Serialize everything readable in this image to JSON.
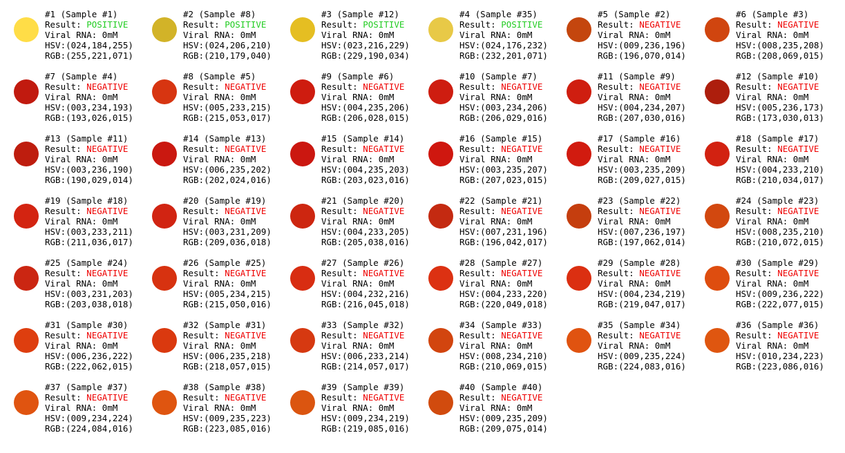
{
  "labels": {
    "result": "Result: ",
    "viral": "Viral RNA: ",
    "hsv": "HSV:",
    "rgb": "RGB:",
    "sample_word": "Sample"
  },
  "colors": {
    "positive": "#22cc22",
    "negative": "#ee0000"
  },
  "samples": [
    {
      "id": "#1",
      "sample": "#1",
      "result": "POSITIVE",
      "rna": "0mM",
      "hsv": "(024,184,255)",
      "rgb": "(255,221,071)",
      "color": "#ffdd47"
    },
    {
      "id": "#2",
      "sample": "#8",
      "result": "POSITIVE",
      "rna": "0mM",
      "hsv": "(024,206,210)",
      "rgb": "(210,179,040)",
      "color": "#d2b328"
    },
    {
      "id": "#3",
      "sample": "#12",
      "result": "POSITIVE",
      "rna": "0mM",
      "hsv": "(023,216,229)",
      "rgb": "(229,190,034)",
      "color": "#e5be22"
    },
    {
      "id": "#4",
      "sample": "#35",
      "result": "POSITIVE",
      "rna": "0mM",
      "hsv": "(024,176,232)",
      "rgb": "(232,201,071)",
      "color": "#e8c947"
    },
    {
      "id": "#5",
      "sample": "#2",
      "result": "NEGATIVE",
      "rna": "0mM",
      "hsv": "(009,236,196)",
      "rgb": "(196,070,014)",
      "color": "#c4460e"
    },
    {
      "id": "#6",
      "sample": "#3",
      "result": "NEGATIVE",
      "rna": "0mM",
      "hsv": "(008,235,208)",
      "rgb": "(208,069,015)",
      "color": "#d0450f"
    },
    {
      "id": "#7",
      "sample": "#4",
      "result": "NEGATIVE",
      "rna": "0mM",
      "hsv": "(003,234,193)",
      "rgb": "(193,026,015)",
      "color": "#c11a0f"
    },
    {
      "id": "#8",
      "sample": "#5",
      "result": "NEGATIVE",
      "rna": "0mM",
      "hsv": "(005,233,215)",
      "rgb": "(215,053,017)",
      "color": "#d73511"
    },
    {
      "id": "#9",
      "sample": "#6",
      "result": "NEGATIVE",
      "rna": "0mM",
      "hsv": "(004,235,206)",
      "rgb": "(206,028,015)",
      "color": "#ce1c0f"
    },
    {
      "id": "#10",
      "sample": "#7",
      "result": "NEGATIVE",
      "rna": "0mM",
      "hsv": "(003,234,206)",
      "rgb": "(206,029,016)",
      "color": "#ce1d10"
    },
    {
      "id": "#11",
      "sample": "#9",
      "result": "NEGATIVE",
      "rna": "0mM",
      "hsv": "(004,234,207)",
      "rgb": "(207,030,016)",
      "color": "#cf1e10"
    },
    {
      "id": "#12",
      "sample": "#10",
      "result": "NEGATIVE",
      "rna": "0mM",
      "hsv": "(005,236,173)",
      "rgb": "(173,030,013)",
      "color": "#ad1e0d"
    },
    {
      "id": "#13",
      "sample": "#11",
      "result": "NEGATIVE",
      "rna": "0mM",
      "hsv": "(003,236,190)",
      "rgb": "(190,029,014)",
      "color": "#be1d0e"
    },
    {
      "id": "#14",
      "sample": "#13",
      "result": "NEGATIVE",
      "rna": "0mM",
      "hsv": "(006,235,202)",
      "rgb": "(202,024,016)",
      "color": "#ca1810"
    },
    {
      "id": "#15",
      "sample": "#14",
      "result": "NEGATIVE",
      "rna": "0mM",
      "hsv": "(004,235,203)",
      "rgb": "(203,023,016)",
      "color": "#cb1710"
    },
    {
      "id": "#16",
      "sample": "#15",
      "result": "NEGATIVE",
      "rna": "0mM",
      "hsv": "(003,235,207)",
      "rgb": "(207,023,015)",
      "color": "#cf170f"
    },
    {
      "id": "#17",
      "sample": "#16",
      "result": "NEGATIVE",
      "rna": "0mM",
      "hsv": "(003,235,209)",
      "rgb": "(209,027,015)",
      "color": "#d11b0f"
    },
    {
      "id": "#18",
      "sample": "#17",
      "result": "NEGATIVE",
      "rna": "0mM",
      "hsv": "(004,233,210)",
      "rgb": "(210,034,017)",
      "color": "#d22211"
    },
    {
      "id": "#19",
      "sample": "#18",
      "result": "NEGATIVE",
      "rna": "0mM",
      "hsv": "(003,233,211)",
      "rgb": "(211,036,017)",
      "color": "#d32411"
    },
    {
      "id": "#20",
      "sample": "#19",
      "result": "NEGATIVE",
      "rna": "0mM",
      "hsv": "(003,231,209)",
      "rgb": "(209,036,018)",
      "color": "#d12412"
    },
    {
      "id": "#21",
      "sample": "#20",
      "result": "NEGATIVE",
      "rna": "0mM",
      "hsv": "(004,233,205)",
      "rgb": "(205,038,016)",
      "color": "#cd2610"
    },
    {
      "id": "#22",
      "sample": "#21",
      "result": "NEGATIVE",
      "rna": "0mM",
      "hsv": "(007,231,196)",
      "rgb": "(196,042,017)",
      "color": "#c42a11"
    },
    {
      "id": "#23",
      "sample": "#22",
      "result": "NEGATIVE",
      "rna": "0mM",
      "hsv": "(007,236,197)",
      "rgb": "(197,062,014)",
      "color": "#c53e0e"
    },
    {
      "id": "#24",
      "sample": "#23",
      "result": "NEGATIVE",
      "rna": "0mM",
      "hsv": "(008,235,210)",
      "rgb": "(210,072,015)",
      "color": "#d2480f"
    },
    {
      "id": "#25",
      "sample": "#24",
      "result": "NEGATIVE",
      "rna": "0mM",
      "hsv": "(003,231,203)",
      "rgb": "(203,038,018)",
      "color": "#cb2612"
    },
    {
      "id": "#26",
      "sample": "#25",
      "result": "NEGATIVE",
      "rna": "0mM",
      "hsv": "(005,234,215)",
      "rgb": "(215,050,016)",
      "color": "#d73210"
    },
    {
      "id": "#27",
      "sample": "#26",
      "result": "NEGATIVE",
      "rna": "0mM",
      "hsv": "(004,232,216)",
      "rgb": "(216,045,018)",
      "color": "#d82d12"
    },
    {
      "id": "#28",
      "sample": "#27",
      "result": "NEGATIVE",
      "rna": "0mM",
      "hsv": "(004,233,220)",
      "rgb": "(220,049,018)",
      "color": "#dc3112"
    },
    {
      "id": "#29",
      "sample": "#28",
      "result": "NEGATIVE",
      "rna": "0mM",
      "hsv": "(004,234,219)",
      "rgb": "(219,047,017)",
      "color": "#db2f11"
    },
    {
      "id": "#30",
      "sample": "#29",
      "result": "NEGATIVE",
      "rna": "0mM",
      "hsv": "(009,236,222)",
      "rgb": "(222,077,015)",
      "color": "#de4d0f"
    },
    {
      "id": "#31",
      "sample": "#30",
      "result": "NEGATIVE",
      "rna": "0mM",
      "hsv": "(006,236,222)",
      "rgb": "(222,062,015)",
      "color": "#de3e0f"
    },
    {
      "id": "#32",
      "sample": "#31",
      "result": "NEGATIVE",
      "rna": "0mM",
      "hsv": "(006,235,218)",
      "rgb": "(218,057,015)",
      "color": "#da390f"
    },
    {
      "id": "#33",
      "sample": "#32",
      "result": "NEGATIVE",
      "rna": "0mM",
      "hsv": "(006,233,214)",
      "rgb": "(214,057,017)",
      "color": "#d63911"
    },
    {
      "id": "#34",
      "sample": "#33",
      "result": "NEGATIVE",
      "rna": "0mM",
      "hsv": "(008,234,210)",
      "rgb": "(210,069,015)",
      "color": "#d2450f"
    },
    {
      "id": "#35",
      "sample": "#34",
      "result": "NEGATIVE",
      "rna": "0mM",
      "hsv": "(009,235,224)",
      "rgb": "(224,083,016)",
      "color": "#e05310"
    },
    {
      "id": "#36",
      "sample": "#36",
      "result": "NEGATIVE",
      "rna": "0mM",
      "hsv": "(010,234,223)",
      "rgb": "(223,086,016)",
      "color": "#df5610"
    },
    {
      "id": "#37",
      "sample": "#37",
      "result": "NEGATIVE",
      "rna": "0mM",
      "hsv": "(009,234,224)",
      "rgb": "(224,084,016)",
      "color": "#e05410"
    },
    {
      "id": "#38",
      "sample": "#38",
      "result": "NEGATIVE",
      "rna": "0mM",
      "hsv": "(009,235,223)",
      "rgb": "(223,085,016)",
      "color": "#df5510"
    },
    {
      "id": "#39",
      "sample": "#39",
      "result": "NEGATIVE",
      "rna": "0mM",
      "hsv": "(009,234,219)",
      "rgb": "(219,085,016)",
      "color": "#db5510"
    },
    {
      "id": "#40",
      "sample": "#40",
      "result": "NEGATIVE",
      "rna": "0mM",
      "hsv": "(009,235,209)",
      "rgb": "(209,075,014)",
      "color": "#d14b0e"
    }
  ]
}
